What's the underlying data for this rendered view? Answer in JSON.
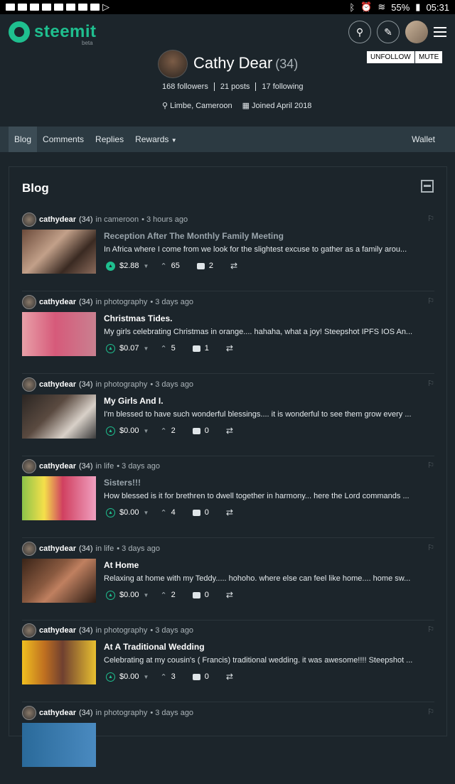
{
  "status": {
    "battery": "55%",
    "time": "05:31"
  },
  "app": {
    "name": "steemit",
    "beta": "beta"
  },
  "profile": {
    "name": "Cathy Dear",
    "reputation": "(34)",
    "followers": "168 followers",
    "posts": "21 posts",
    "following": "17 following",
    "location": "Limbe, Cameroon",
    "joined": "Joined April 2018",
    "unfollow_label": "UNFOLLOW",
    "mute_label": "MUTE"
  },
  "tabs": {
    "blog": "Blog",
    "comments": "Comments",
    "replies": "Replies",
    "rewards": "Rewards",
    "wallet": "Wallet"
  },
  "panel": {
    "title": "Blog"
  },
  "posts": [
    {
      "author": "cathydear",
      "rep": "(34)",
      "category": "in cameroon",
      "time": "• 3 hours ago",
      "title": "Reception After The Monthly Family Meeting",
      "body": "In Africa where I come from we look for the slightest excuse to gather as a family arou...",
      "payout": "$2.88",
      "votes": "65",
      "comments": "2"
    },
    {
      "author": "cathydear",
      "rep": "(34)",
      "category": "in photography",
      "time": "• 3 days ago",
      "title": "Christmas Tides.",
      "body": "My girls celebrating Christmas in orange.... hahaha, what a joy! Steepshot IPFS IOS An...",
      "payout": "$0.07",
      "votes": "5",
      "comments": "1"
    },
    {
      "author": "cathydear",
      "rep": "(34)",
      "category": "in photography",
      "time": "• 3 days ago",
      "title": "My Girls And I.",
      "body": "I'm blessed to have such wonderful blessings.... it is wonderful to see them grow every ...",
      "payout": "$0.00",
      "votes": "2",
      "comments": "0"
    },
    {
      "author": "cathydear",
      "rep": "(34)",
      "category": "in life",
      "time": "• 3 days ago",
      "title": "Sisters!!!",
      "body": "How blessed is it for brethren to dwell together in harmony... here the Lord commands ...",
      "payout": "$0.00",
      "votes": "4",
      "comments": "0"
    },
    {
      "author": "cathydear",
      "rep": "(34)",
      "category": "in life",
      "time": "• 3 days ago",
      "title": "At Home",
      "body": "Relaxing at home with my Teddy..... hohoho. where else can feel like home.... home sw...",
      "payout": "$0.00",
      "votes": "2",
      "comments": "0"
    },
    {
      "author": "cathydear",
      "rep": "(34)",
      "category": "in photography",
      "time": "• 3 days ago",
      "title": "At A Traditional Wedding",
      "body": "Celebrating at my cousin's ( Francis) traditional wedding. it was awesome!!!! Steepshot ...",
      "payout": "$0.00",
      "votes": "3",
      "comments": "0"
    },
    {
      "author": "cathydear",
      "rep": "(34)",
      "category": "in photography",
      "time": "• 3 days ago",
      "title": "",
      "body": "",
      "payout": "",
      "votes": "",
      "comments": ""
    }
  ]
}
